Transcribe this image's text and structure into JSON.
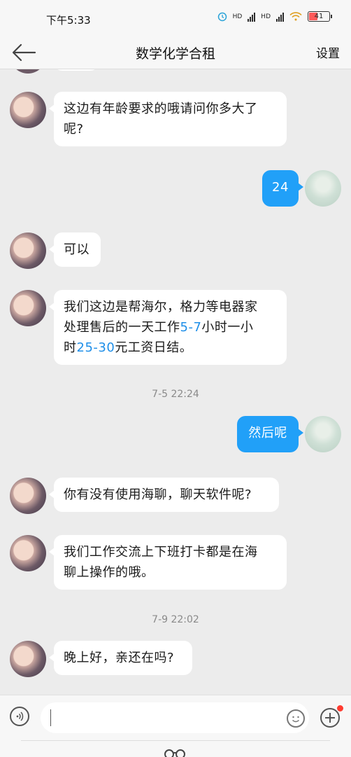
{
  "status_bar": {
    "time": "下午5:33",
    "hd1": "HD",
    "hd2": "HD",
    "battery": "41",
    "battery_level": 0.41
  },
  "header": {
    "title": "数学化学合租",
    "settings_label": "设置"
  },
  "messages": [
    {
      "id": 1,
      "side": "left",
      "lines": [
        "这边有年龄要求的哦请问你多大了",
        "呢?"
      ]
    },
    {
      "id": 2,
      "side": "right",
      "text": "24"
    },
    {
      "id": 3,
      "side": "left",
      "lines": [
        "可以"
      ]
    },
    {
      "id": 4,
      "side": "left",
      "line1": "我们这边是帮海尔，格力等电器家",
      "line2_a": "处理售后的一天工作",
      "line2_b": "5-7",
      "line2_c": "小时一小",
      "line3_a": "时",
      "line3_b": "25-30",
      "line3_c": "元工资日结。"
    },
    {
      "id": 5,
      "side": "right",
      "text": "然后呢"
    },
    {
      "id": 6,
      "side": "left",
      "lines": [
        "你有没有使用海聊，聊天软件呢?"
      ]
    },
    {
      "id": 7,
      "side": "left",
      "lines": [
        "我们工作交流上下班打卡都是在海",
        "聊上操作的哦。"
      ]
    },
    {
      "id": 8,
      "side": "left",
      "lines": [
        "晚上好，亲还在吗?"
      ]
    }
  ],
  "timestamps": [
    "7-5 22:24",
    "7-9 22:02"
  ],
  "input": {
    "value": "",
    "placeholder": ""
  },
  "icons": {
    "back": "back-arrow-icon",
    "voice": "voice-icon",
    "emoji": "emoji-icon",
    "plus": "plus-icon",
    "avatar_other": "contact-avatar",
    "avatar_me": "my-avatar"
  },
  "colors": {
    "bubble_sent": "#21a0f8",
    "bubble_received": "#ffffff",
    "highlight": "#1f8fe8",
    "badge": "#ff3b30",
    "background": "#ececec"
  }
}
